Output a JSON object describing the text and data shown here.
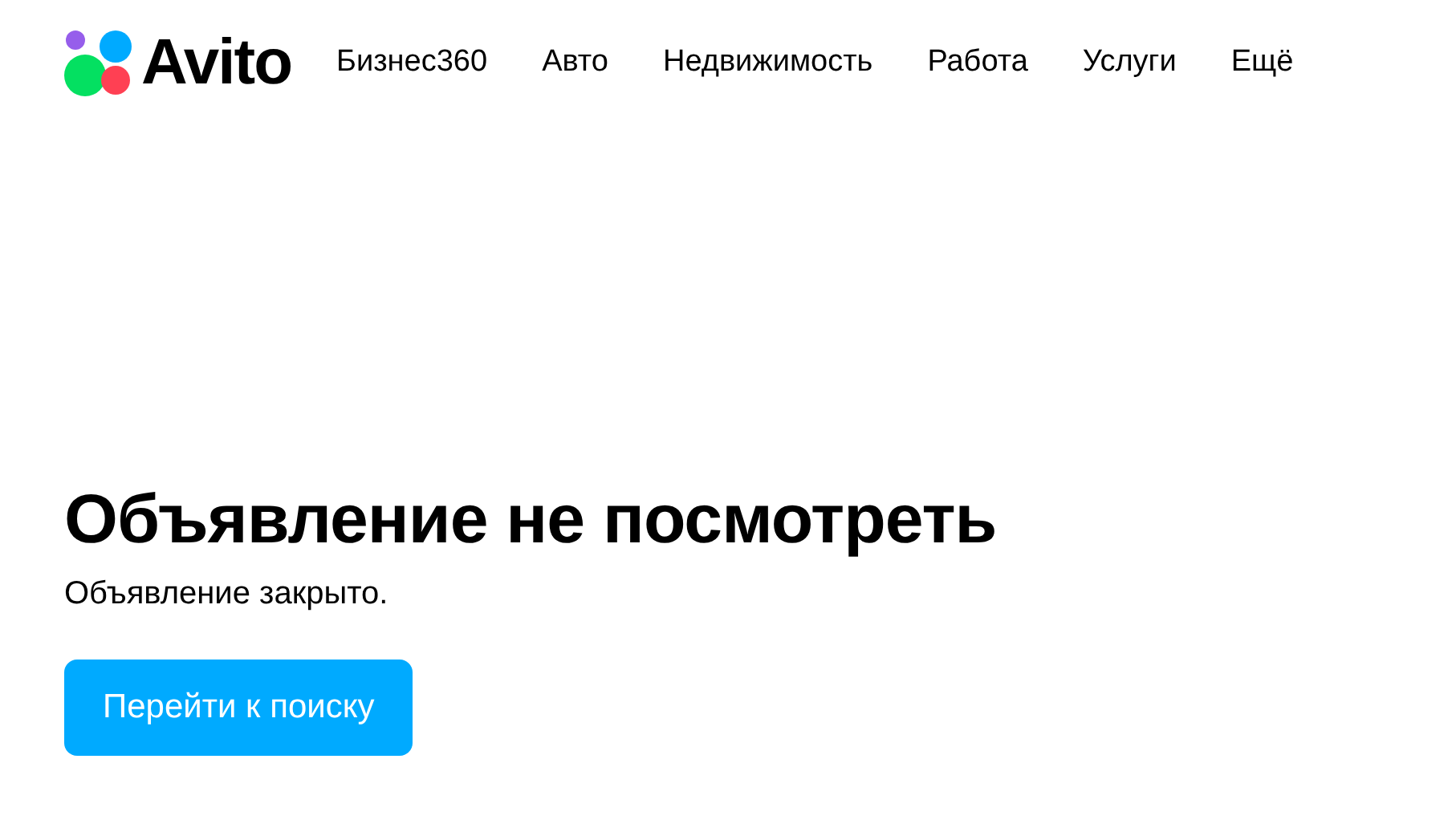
{
  "header": {
    "logo": "Avito",
    "nav": [
      {
        "label": "Бизнес360"
      },
      {
        "label": "Авто"
      },
      {
        "label": "Недвижимость"
      },
      {
        "label": "Работа"
      },
      {
        "label": "Услуги"
      },
      {
        "label": "Ещё"
      }
    ]
  },
  "notice": {
    "title": "Объявление не посмотреть",
    "message": "Объявление закрыто.",
    "button": "Перейти к поиску"
  }
}
